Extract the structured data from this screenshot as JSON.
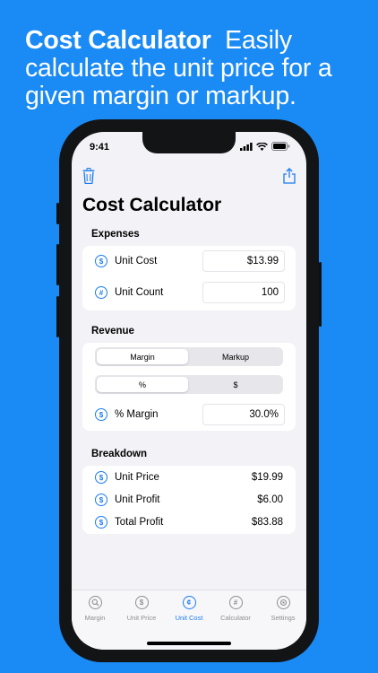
{
  "headline": {
    "bold": "Cost Calculator",
    "rest": "Easily calculate the unit price for a given margin or markup."
  },
  "status": {
    "time": "9:41"
  },
  "nav": {
    "trash_icon": "trash-icon",
    "share_icon": "share-icon"
  },
  "page": {
    "title": "Cost Calculator"
  },
  "expenses": {
    "label": "Expenses",
    "unit_cost": {
      "label": "Unit Cost",
      "icon": "$",
      "value": "$13.99"
    },
    "unit_count": {
      "label": "Unit Count",
      "icon": "#",
      "value": "100"
    }
  },
  "revenue": {
    "label": "Revenue",
    "mode_segment": {
      "options": [
        "Margin",
        "Markup"
      ],
      "selected": "Margin"
    },
    "unit_segment": {
      "options": [
        "%",
        "$"
      ],
      "selected": "%"
    },
    "margin": {
      "label": "% Margin",
      "icon": "$",
      "value": "30.0%"
    }
  },
  "breakdown": {
    "label": "Breakdown",
    "rows": [
      {
        "label": "Unit Price",
        "icon": "$",
        "value": "$19.99"
      },
      {
        "label": "Unit Profit",
        "icon": "$",
        "value": "$6.00"
      },
      {
        "label": "Total Profit",
        "icon": "$",
        "value": "$83.88"
      }
    ]
  },
  "tabs": [
    {
      "label": "Margin",
      "icon": "magnifier-icon",
      "glyph": ""
    },
    {
      "label": "Unit Price",
      "icon": "dollar-icon",
      "glyph": "$"
    },
    {
      "label": "Unit Cost",
      "icon": "cent-icon",
      "glyph": "¢"
    },
    {
      "label": "Calculator",
      "icon": "hash-icon",
      "glyph": "#"
    },
    {
      "label": "Settings",
      "icon": "gear-icon",
      "glyph": ""
    }
  ],
  "colors": {
    "background": "#1a8af5",
    "accent": "#1a7cf0",
    "screen": "#f2f2f7"
  }
}
